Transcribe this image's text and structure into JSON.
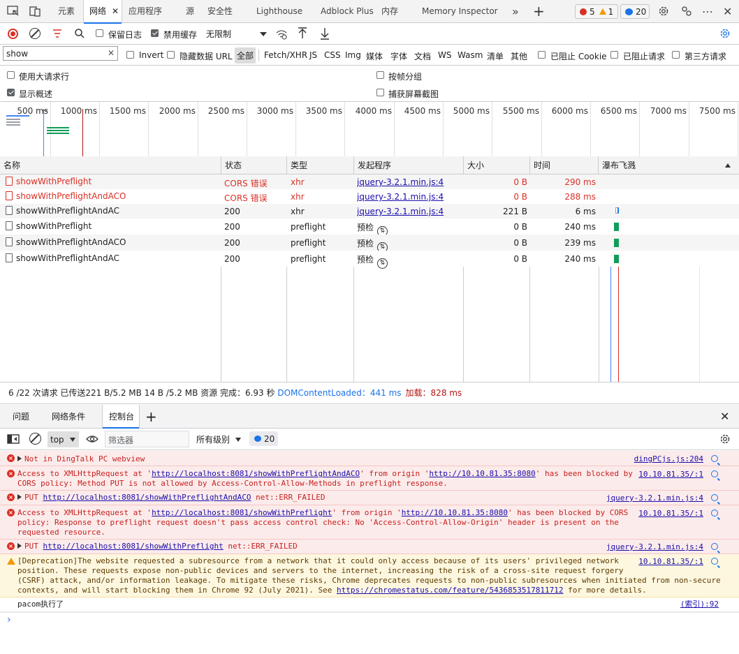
{
  "tabs": [
    "元素",
    "网络",
    "应用程序",
    "源",
    "安全性",
    "Lighthouse",
    "Adblock Plus",
    "内存",
    "Memory Inspector"
  ],
  "counts": {
    "errors": "5",
    "warnings": "1",
    "messages": "20"
  },
  "net_toolbar": {
    "preserve_log": "保留日志",
    "disable_cache": "禁用缓存",
    "throttle": "无限制"
  },
  "filter": {
    "value": "show",
    "invert": "Invert",
    "hide_data_url": "隐藏数据 URL",
    "types": [
      "全部",
      "Fetch/XHR",
      "JS",
      "CSS",
      "Img",
      "媒体",
      "字体",
      "文档",
      "WS",
      "Wasm",
      "清单",
      "其他"
    ],
    "blocked_cookie": "已阻止 Cookie",
    "blocked_req": "已阻止请求",
    "third_party": "第三方请求"
  },
  "options": {
    "large_rows": "使用大请求行",
    "group_frame": "按帧分组",
    "show_overview": "显示概述",
    "capture_screens": "捕获屏幕截图"
  },
  "overview_ticks": [
    "500 ms",
    "1000 ms",
    "1500 ms",
    "2000 ms",
    "2500 ms",
    "3000 ms",
    "3500 ms",
    "4000 ms",
    "4500 ms",
    "5000 ms",
    "5500 ms",
    "6000 ms",
    "6500 ms",
    "7000 ms",
    "7500 ms"
  ],
  "columns": [
    "名称",
    "状态",
    "类型",
    "发起程序",
    "大小",
    "时间",
    "瀑布飞溅"
  ],
  "rows": [
    {
      "name": "showWithPreflight",
      "status": "CORS 错误",
      "type": "xhr",
      "initiator": "jquery-3.2.1.min.js:4",
      "size": "0 B",
      "time": "290 ms"
    },
    {
      "name": "showWithPreflightAndACO",
      "status": "CORS 错误",
      "type": "xhr",
      "initiator": "jquery-3.2.1.min.js:4",
      "size": "0 B",
      "time": "288 ms"
    },
    {
      "name": "showWithPreflightAndAC",
      "status": "200",
      "type": "xhr",
      "initiator": "jquery-3.2.1.min.js:4",
      "size": "221 B",
      "time": "6 ms"
    },
    {
      "name": "showWithPreflight",
      "status": "200",
      "type": "preflight",
      "initiator": "预检",
      "size": "0 B",
      "time": "240 ms"
    },
    {
      "name": "showWithPreflightAndACO",
      "status": "200",
      "type": "preflight",
      "initiator": "预检",
      "size": "0 B",
      "time": "239 ms"
    },
    {
      "name": "showWithPreflightAndAC",
      "status": "200",
      "type": "preflight",
      "initiator": "预检",
      "size": "0 B",
      "time": "240 ms"
    }
  ],
  "summary": {
    "a": "6 /22 次请求  已传送221 B/5.2 MB  14 B /5.2 MB 资源  完成：6.93 秒  ",
    "dcl": "DOMContentLoaded：441 ms",
    "load": "加载：828 ms"
  },
  "drawer_tabs": [
    "问题",
    "网络条件",
    "控制台"
  ],
  "console_toolbar": {
    "context": "top",
    "filter_placeholder": "筛选器",
    "levels": "所有级别",
    "count": "20"
  },
  "messages": [
    {
      "text": "Not in DingTalk PC webview",
      "src": "dingPCjs.js:204"
    },
    {
      "l1a": "Access to XMLHttpRequest at '",
      "l1u1": "http://localhost:8081/showWithPreflightAndACO",
      "l1b": "' from origin '",
      "l1u2": "http://10.10.81.35:8080",
      "l1c": "' has been blocked by",
      "l2": "CORS policy: Method PUT is not allowed by Access-Control-Allow-Methods in preflight response.",
      "src": "10.10.81.35/:1"
    },
    {
      "pre": "PUT ",
      "url": "http://localhost:8081/showWithPreflightAndACO",
      "post": " net::ERR_FAILED",
      "src": "jquery-3.2.1.min.js:4"
    },
    {
      "l1a": "Access to XMLHttpRequest at '",
      "l1u1": "http://localhost:8081/showWithPreflight",
      "l1b": "' from origin '",
      "l1u2": "http://10.10.81.35:8080",
      "l1c": "' has been blocked by CORS",
      "l2": "policy: Response to preflight request doesn't pass access control check: No 'Access-Control-Allow-Origin' header is present on the",
      "l3": "requested resource.",
      "src": "10.10.81.35/:1"
    },
    {
      "pre": "PUT ",
      "url": "http://localhost:8081/showWithPreflight",
      "post": " net::ERR_FAILED",
      "src": "jquery-3.2.1.min.js:4"
    },
    {
      "l1": "[Deprecation]The website requested a subresource from a network that it could only access because of its users' privileged network",
      "l2": "position. These requests expose non-public devices and servers to the internet, increasing the risk of a cross-site request forgery",
      "l3": "(CSRF) attack, and/or information leakage. To mitigate these risks, Chrome deprecates requests to non-public subresources when initiated from non-secure",
      "l4a": "contexts, and will start blocking them in Chrome 92 (July 2021). See ",
      "l4u": "https://chromestatus.com/feature/5436853517811712",
      "l4b": " for more details.",
      "src": "10.10.81.35/:1"
    },
    {
      "text": "pacom执行了",
      "src": "(索引):92"
    }
  ]
}
